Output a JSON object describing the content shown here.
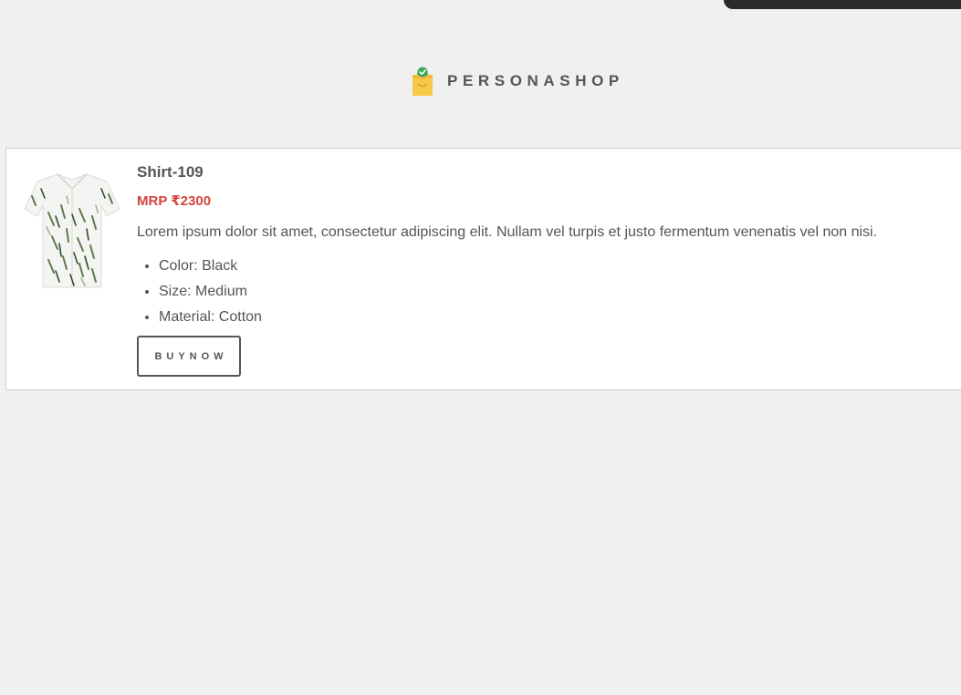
{
  "brand": {
    "name": "PERSONASHOP",
    "logo_icon": "shopping-bag-check-icon",
    "logo_color": "#f7c948",
    "check_color": "#3aa757"
  },
  "product": {
    "title": "Shirt-109",
    "price": "MRP ₹2300",
    "price_color": "#d0453d",
    "description": "Lorem ipsum dolor sit amet, consectetur adipiscing elit. Nullam vel turpis et justo fermentum venenatis vel non nisi.",
    "attributes": [
      "Color: Black",
      "Size: Medium",
      "Material: Cotton"
    ],
    "buy_label": "BUYNOW",
    "image_icon": "shirt-image"
  }
}
